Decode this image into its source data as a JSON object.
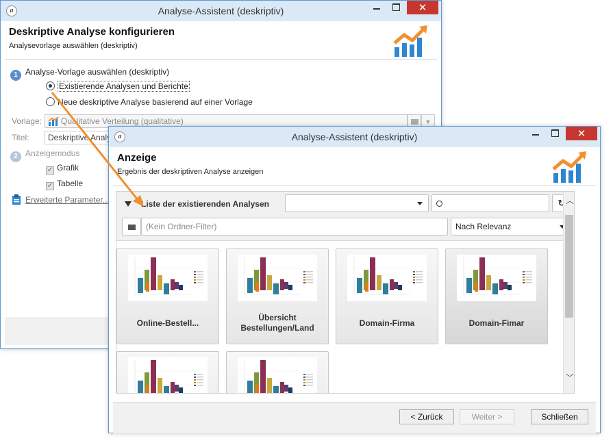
{
  "back_window": {
    "title": "Analyse-Assistent (deskriptiv)",
    "heading": "Deskriptive Analyse konfigurieren",
    "subheading": "Analysevorlage auswählen (deskriptiv)",
    "step1": {
      "num": "1",
      "label": "Analyse-Vorlage auswählen (deskriptiv)"
    },
    "radio_existing": "Existierende Analysen und Berichte",
    "radio_new": "Neue deskriptive Analyse basierend auf einer Vorlage",
    "vorlage_label": "Vorlage:",
    "vorlage_value": "Qualitative Verteilung (qualitative)",
    "titel_label": "Titel:",
    "titel_value": "Deskriptive Analy",
    "step2": {
      "num": "2",
      "label": "Anzeigemodus"
    },
    "chk_grafik": "Grafik",
    "chk_tabelle": "Tabelle",
    "advanced_link": "Erweiterte Parameter..."
  },
  "front_window": {
    "title": "Analyse-Assistent (deskriptiv)",
    "heading": "Anzeige",
    "subheading": "Ergebnis der deskriptiven Analyse anzeigen",
    "list_title": "Liste der existierenden Analysen",
    "dropdown_value": "",
    "search_value": "",
    "folder_placeholder": "(Kein Ordner-Filter)",
    "sort_value": "Nach Relevanz",
    "cards": [
      {
        "label": "Online-Bestell..."
      },
      {
        "label": "Übersicht Bestellungen/Land"
      },
      {
        "label": "Domain-Firma"
      },
      {
        "label": "Domain-Fimar"
      },
      {
        "label": ""
      },
      {
        "label": ""
      }
    ],
    "btn_back": "< Zurück",
    "btn_next": "Weiter >",
    "btn_close": "Schließen"
  },
  "colors": {
    "accent": "#5c8fc7",
    "titlebar": "#dbe9f7",
    "close": "#c7372f",
    "arrow": "#f0902e",
    "logo_orange": "#f0902e",
    "logo_blue": "#2f86d0"
  }
}
